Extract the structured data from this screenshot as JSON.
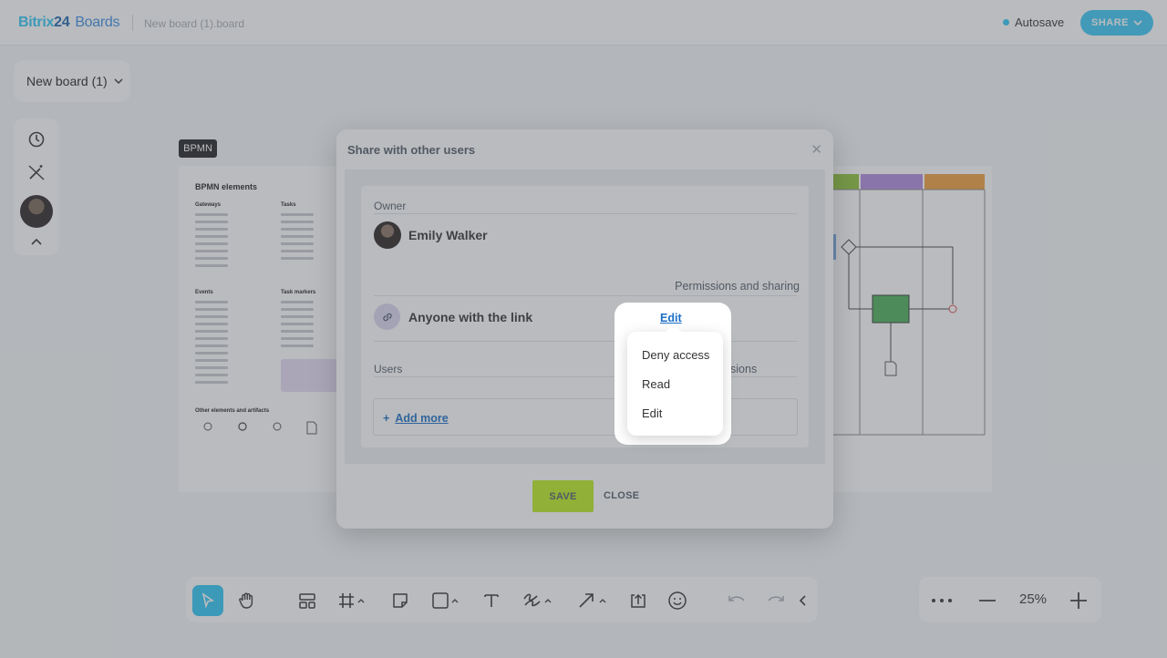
{
  "header": {
    "logo_main": "Bitrix",
    "logo_num": "24",
    "logo_product": "Boards",
    "filename": "New board (1).board",
    "autosave_label": "Autosave",
    "share_label": "SHARE"
  },
  "board": {
    "selector_label": "New board (1)",
    "bpmn_tag": "BPMN",
    "frame_title": "BPMN elements",
    "col_gateways": "Gateways",
    "col_tasks": "Tasks",
    "col_events": "Events",
    "col_task_markers": "Task markers",
    "col_other": "Other elements and artifacts"
  },
  "zoom": {
    "level": "25%"
  },
  "modal": {
    "title": "Share with other users",
    "owner_label": "Owner",
    "owner_name": "Emily Walker",
    "permissions_header": "Permissions and sharing",
    "link_access_label": "Anyone with the link",
    "users_label": "Users",
    "users_permissions_header": "issions",
    "add_more_label": "Add more",
    "save_label": "SAVE",
    "close_label": "CLOSE"
  },
  "permission_dropdown": {
    "current": "Edit",
    "options": [
      "Deny access",
      "Read",
      "Edit"
    ]
  },
  "colors": {
    "accent": "#2fc6f6",
    "save_button": "#bbed21",
    "link": "#1d6fc7"
  }
}
